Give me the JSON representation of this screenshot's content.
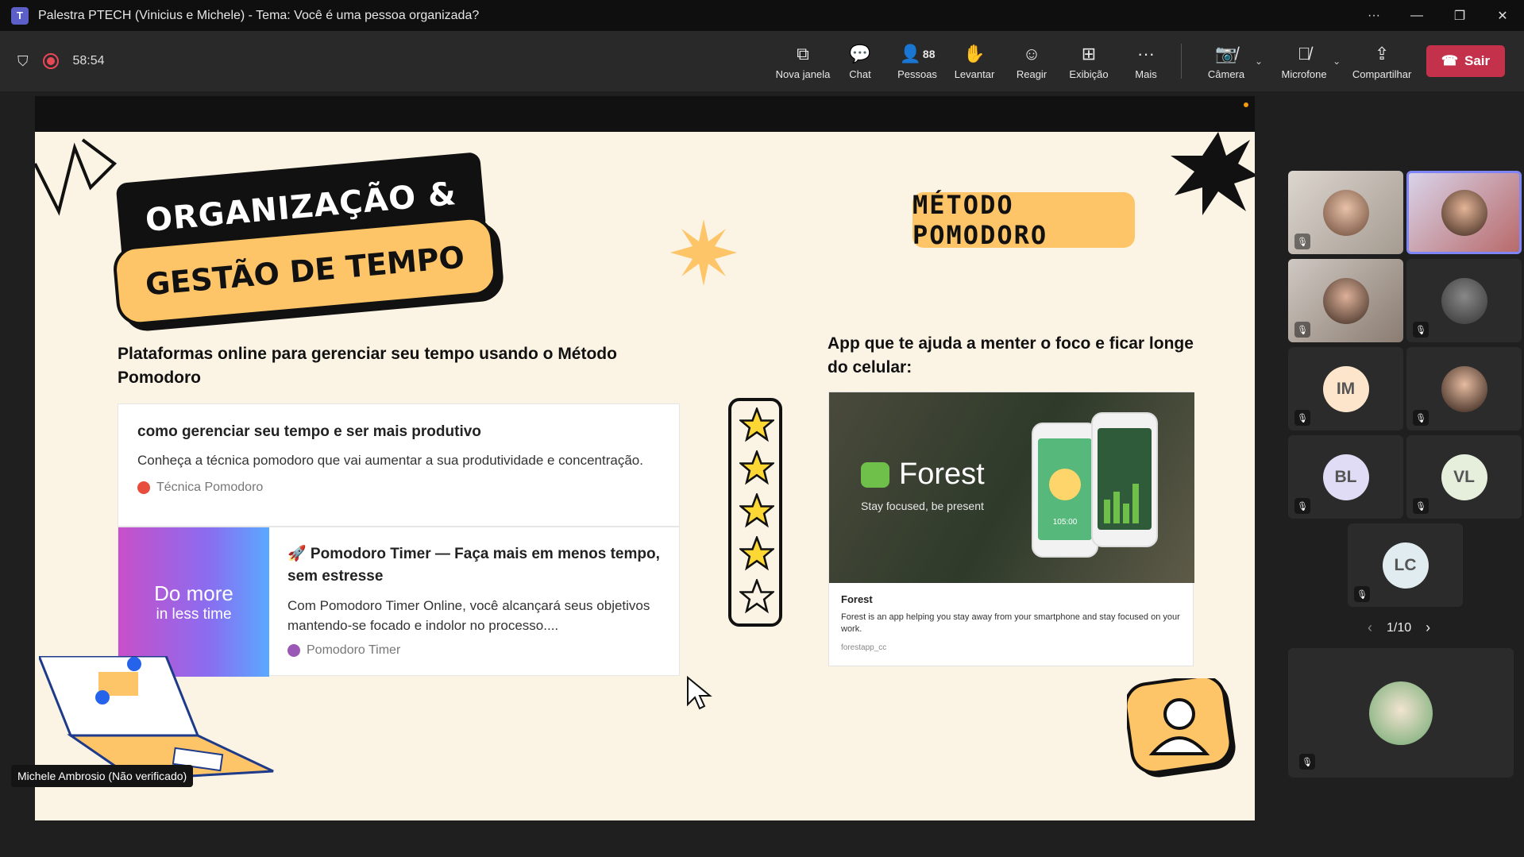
{
  "window": {
    "title": "Palestra PTECH (Vinicius e Michele) - Tema: Você é uma pessoa organizada?"
  },
  "toolbar": {
    "timer": "58:54",
    "people_count": "88",
    "tools": {
      "new_window": "Nova janela",
      "chat": "Chat",
      "people": "Pessoas",
      "raise": "Levantar",
      "react": "Reagir",
      "view": "Exibição",
      "more": "Mais",
      "camera": "Câmera",
      "mic": "Microfone",
      "share": "Compartilhar",
      "leave": "Sair"
    }
  },
  "slide": {
    "title_line1": "ORGANIZAÇÃO &",
    "title_line2": "GESTÃO DE TEMPO",
    "badge": "MÉTODO POMODORO",
    "left_heading": "Plataformas online para gerenciar seu tempo usando o Método Pomodoro",
    "right_heading": "App que te ajuda a menter o foco e ficar longe do celular:",
    "card1": {
      "title": "como gerenciar seu tempo e ser mais produtivo",
      "desc": "Conheça a técnica pomodoro que vai aumentar a sua produtividade e concentração.",
      "source": "Técnica Pomodoro"
    },
    "card2": {
      "image_line1": "Do more",
      "image_line2": "in less time",
      "title": "🚀 Pomodoro Timer — Faça mais em menos tempo, sem estresse",
      "desc": "Com Pomodoro Timer Online, você alcançará seus objetivos mantendo-se focado e indolor no processo....",
      "source": "Pomodoro Timer"
    },
    "forest": {
      "brand": "Forest",
      "tagline": "Stay focused, be present",
      "timer": "105:00",
      "title": "Forest",
      "desc": "Forest is an app helping you stay away from your smartphone and stay focused on your work.",
      "source": "forestapp_cc"
    },
    "rating": {
      "filled": 4,
      "total": 5
    }
  },
  "presenter_label": "Michele Ambrosio (Não verificado)",
  "participants": {
    "initials": [
      "IM",
      "BL",
      "VL",
      "LC"
    ],
    "page": "1/10"
  },
  "colors": {
    "accent": "#fdc567",
    "leave": "#c4314b",
    "selected": "#7f85f5"
  }
}
